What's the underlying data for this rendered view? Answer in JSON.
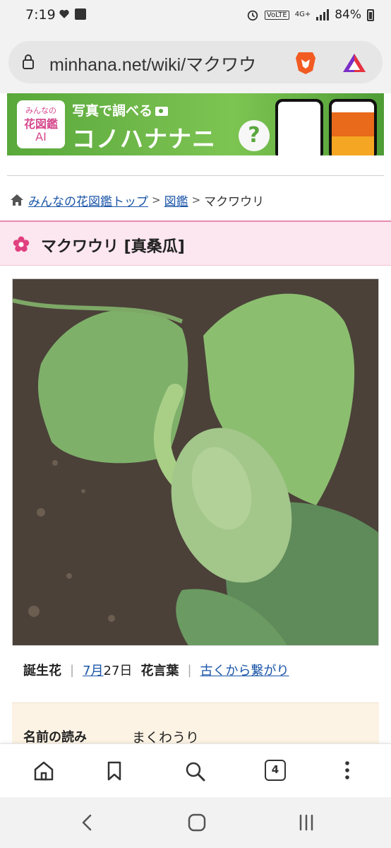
{
  "status_bar": {
    "time": "7:19",
    "volte": "VoLTE",
    "network": "4G+",
    "battery": "84%"
  },
  "browser": {
    "url": "minhana.net/wiki/マクワウ"
  },
  "banner": {
    "logo_line1": "みんなの",
    "logo_line2": "花図鑑",
    "logo_line3": "AI",
    "subtitle": "写真で調べる",
    "headline": "コノハナナニ",
    "question": "?"
  },
  "breadcrumb": {
    "home": "みんなの花図鑑トップ",
    "sep1": ">",
    "section": "図鑑",
    "sep2": ">",
    "current": "マクワウリ"
  },
  "page": {
    "title": "マクワウリ [真桑瓜]"
  },
  "info": {
    "birth_flower_label": "誕生花",
    "month_link": "7月",
    "day": "27日",
    "language_label": "花言葉",
    "language_link": "古くから繋がり"
  },
  "details": {
    "reading_label": "名前の読み",
    "reading_value": "まくわうり"
  },
  "toolbar": {
    "tab_count": "4"
  },
  "colors": {
    "accent_pink": "#e88ab3",
    "link_blue": "#1a55a8",
    "title_band": "#fce6ef",
    "table_bg": "#fdf3e4"
  }
}
